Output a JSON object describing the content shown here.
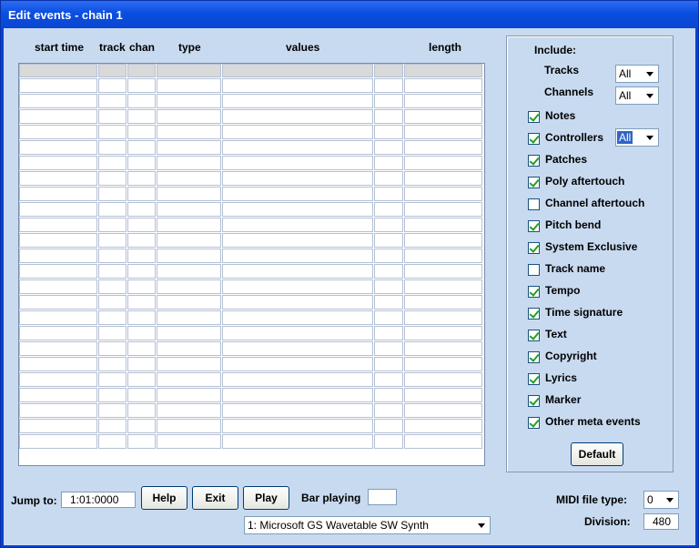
{
  "window": {
    "title": "Edit events - chain 1"
  },
  "grid": {
    "columns": [
      "start time",
      "track",
      "chan",
      "type",
      "values",
      "length"
    ],
    "row_count": 25
  },
  "include": {
    "label": "Include:",
    "tracks": {
      "label": "Tracks",
      "value": "All"
    },
    "channels": {
      "label": "Channels",
      "value": "All"
    },
    "options": [
      {
        "label": "Notes",
        "checked": true
      },
      {
        "label": "Controllers",
        "checked": true
      },
      {
        "label": "Patches",
        "checked": true
      },
      {
        "label": "Poly aftertouch",
        "checked": true
      },
      {
        "label": "Channel aftertouch",
        "checked": false
      },
      {
        "label": "Pitch bend",
        "checked": true
      },
      {
        "label": "System Exclusive",
        "checked": true
      },
      {
        "label": "Track name",
        "checked": false
      },
      {
        "label": "Tempo",
        "checked": true
      },
      {
        "label": "Time signature",
        "checked": true
      },
      {
        "label": "Text",
        "checked": true
      },
      {
        "label": "Copyright",
        "checked": true
      },
      {
        "label": "Lyrics",
        "checked": true
      },
      {
        "label": "Marker",
        "checked": true
      },
      {
        "label": "Other meta events",
        "checked": true
      }
    ],
    "controllers_value": "All",
    "default_label": "Default"
  },
  "bottom": {
    "jump_label": "Jump to:",
    "jump_value": "1:01:0000",
    "help_label": "Help",
    "exit_label": "Exit",
    "play_label": "Play",
    "bar_playing_label": "Bar playing",
    "bar_playing_value": "",
    "synth_value": "1: Microsoft GS Wavetable SW Synth",
    "midi_type_label": "MIDI file type:",
    "midi_type_value": "0",
    "division_label": "Division:",
    "division_value": "480"
  }
}
